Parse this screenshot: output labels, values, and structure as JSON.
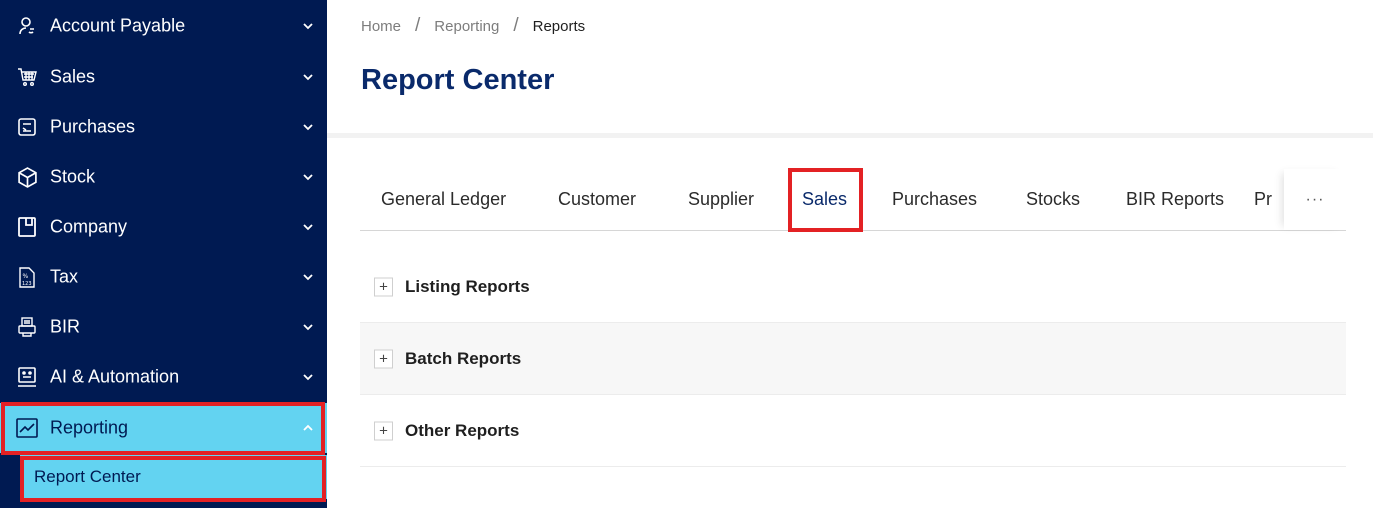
{
  "sidebar": {
    "items": [
      {
        "label": "Account Payable",
        "icon": "account-payable-icon"
      },
      {
        "label": "Sales",
        "icon": "cart-icon"
      },
      {
        "label": "Purchases",
        "icon": "receipt-icon"
      },
      {
        "label": "Stock",
        "icon": "box-icon"
      },
      {
        "label": "Company",
        "icon": "building-icon"
      },
      {
        "label": "Tax",
        "icon": "percent-icon"
      },
      {
        "label": "BIR",
        "icon": "printer-icon"
      },
      {
        "label": "AI & Automation",
        "icon": "robot-icon"
      },
      {
        "label": "Reporting",
        "icon": "chart-line-icon"
      }
    ],
    "sub_item": "Report Center",
    "colors": {
      "bg": "#001a52",
      "active_bg": "#63d3f1",
      "highlight": "#e32124"
    }
  },
  "breadcrumb": {
    "items": [
      "Home",
      "Reporting",
      "Reports"
    ],
    "separator": "/"
  },
  "page_title": "Report Center",
  "tabs": {
    "items": [
      "General Ledger",
      "Customer",
      "Supplier",
      "Sales",
      "Purchases",
      "Stocks",
      "BIR Reports",
      "Pr"
    ],
    "active": "Sales",
    "more": "···"
  },
  "collapse": {
    "panels": [
      {
        "title": "Listing Reports"
      },
      {
        "title": "Batch Reports"
      },
      {
        "title": "Other Reports"
      }
    ]
  }
}
